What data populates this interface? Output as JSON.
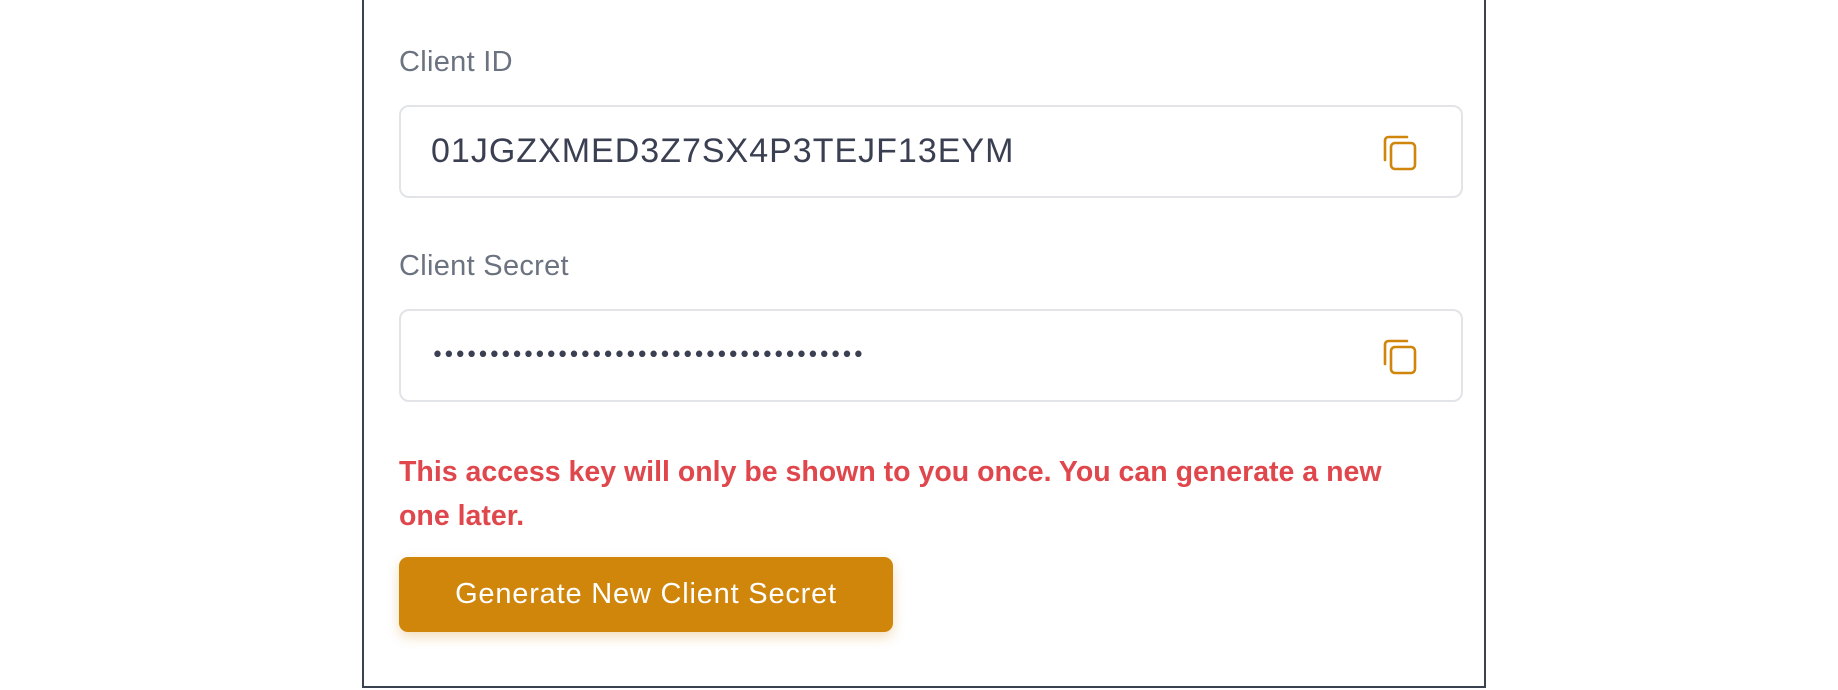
{
  "client_id": {
    "label": "Client ID",
    "value": "01JGZXMED3Z7SX4P3TEJF13EYM",
    "copy_icon": "copy-icon"
  },
  "client_secret": {
    "label": "Client Secret",
    "value": "••••••••••••••••••••••••••••••••••••••",
    "copy_icon": "copy-icon"
  },
  "warning_text": "This access key will only be shown to you once. You can generate a new one later.",
  "generate_button_label": "Generate New Client Secret",
  "colors": {
    "accent": "#d0860b",
    "warning": "#e0474c",
    "label": "#6b7280",
    "value": "#3b3f52",
    "panel_border": "#3a4250"
  }
}
